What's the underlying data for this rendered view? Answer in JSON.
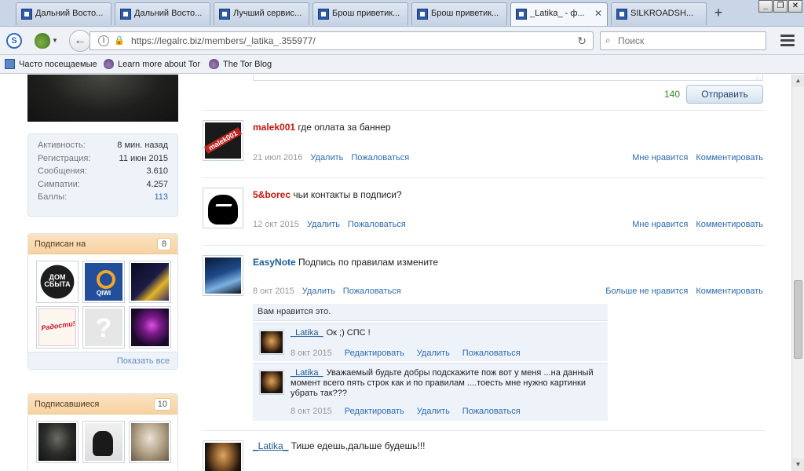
{
  "browser": {
    "tabs": [
      {
        "title": "Дальний Восто...",
        "active": false
      },
      {
        "title": "Дальний Восто...",
        "active": false
      },
      {
        "title": "Лучший сервис...",
        "active": false
      },
      {
        "title": "Брош приветик...",
        "active": false
      },
      {
        "title": "Брош приветик...",
        "active": false
      },
      {
        "title": "_Latika_ - ф...",
        "active": true
      },
      {
        "title": "SILKROADSH...",
        "active": false
      }
    ],
    "url": "https://legalrc.biz/members/_latika_.355977/",
    "search_placeholder": "Поиск",
    "bookmarks": [
      "Часто посещаемые",
      "Learn more about Tor",
      "The Tor Blog"
    ]
  },
  "sidebar": {
    "stats": [
      {
        "label": "Активность:",
        "value": "8 мин. назад"
      },
      {
        "label": "Регистрация:",
        "value": "11 июн 2015"
      },
      {
        "label": "Сообщения:",
        "value": "3.610"
      },
      {
        "label": "Симпатии:",
        "value": "4.257"
      },
      {
        "label": "Баллы:",
        "value": "113"
      }
    ],
    "following": {
      "title": "Подписан на",
      "count": "8",
      "show_all": "Показать все"
    },
    "followers": {
      "title": "Подписавшиеся",
      "count": "10"
    },
    "thumb_text": {
      "dom": "ДОМ СБЫТА",
      "qiwi": "QIWI",
      "radosti": "Радости!",
      "question": "?"
    }
  },
  "composer": {
    "counter": "140",
    "send_label": "Отправить"
  },
  "posts": [
    {
      "user": "malek001",
      "text": "где оплата за баннер",
      "date": "21 июл 2016",
      "actions": [
        "Удалить",
        "Пожаловаться"
      ],
      "right": [
        "Мне нравится",
        "Комментировать"
      ],
      "avatar_text": "malek001"
    },
    {
      "user": "5&borec",
      "text": "чьи контакты в подписи?",
      "date": "12 окт 2015",
      "actions": [
        "Удалить",
        "Пожаловаться"
      ],
      "right": [
        "Мне нравится",
        "Комментировать"
      ]
    },
    {
      "user": "EasyNote",
      "text": "Подпись по правилам измените",
      "date": "8 окт 2015",
      "actions": [
        "Удалить",
        "Пожаловаться"
      ],
      "right": [
        "Больше не нравится",
        "Комментировать"
      ]
    },
    {
      "user": "_Latika_",
      "text": "Тише едешь,дальше будешь!!!"
    }
  ],
  "likes_text": "Вам нравится это.",
  "comments": [
    {
      "user": "_Latika_",
      "text": "Ок ;) СПС !",
      "date": "8 окт 2015",
      "actions": [
        "Редактировать",
        "Удалить",
        "Пожаловаться"
      ]
    },
    {
      "user": "_Latika_",
      "text": "Уважаемый будьте добры подскажите пож вот у меня ...на данный момент всего пять строк как и по правилам ....тоесть мне нужно картинки убрать так???",
      "date": "8 окт 2015",
      "actions": [
        "Редактировать",
        "Удалить",
        "Пожаловаться"
      ]
    }
  ]
}
